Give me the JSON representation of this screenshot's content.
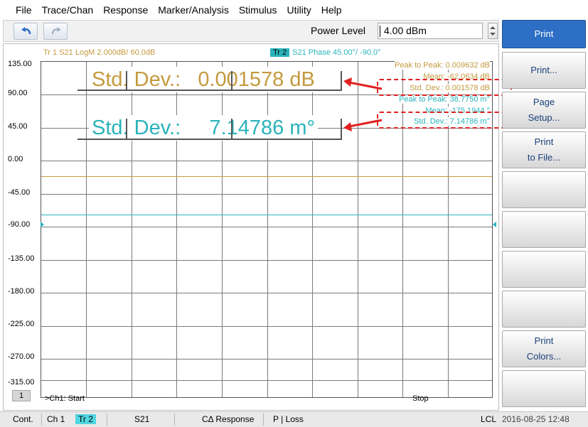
{
  "menu": [
    "File",
    "Trace/Chan",
    "Response",
    "Marker/Analysis",
    "Stimulus",
    "Utility",
    "Help"
  ],
  "toolbar": {
    "undo_icon": "undo-icon",
    "redo_icon": "redo-icon",
    "power_label": "Power Level",
    "power_value": "4.00 dBm"
  },
  "traces": {
    "tr1": "Tr  1   S21 LogM 2.000dB/  60.0dB",
    "tr2_badge": "Tr  2",
    "tr2": "S21 Phase 45.00°/  -90.0°"
  },
  "y_ticks": [
    "135.00",
    "90.00",
    "45.00",
    "0.00",
    "-45.00",
    "-90.00",
    "-135.00",
    "-180.00",
    "-225.00",
    "-270.00",
    "-315.00"
  ],
  "stats": {
    "tr1_peak": "Peak to Peak:  0.009632 dB",
    "tr1_mean": "Mean:  -62.0634 dB",
    "tr1_std": "Std. Dev.:  0.001578 dB",
    "tr2_peak": "Peak to Peak:  38.7750 m°",
    "tr2_mean": "Mean:  -175.1944 °",
    "tr2_std": "Std. Dev.:  7.14786 m°"
  },
  "callouts": {
    "gold_label": "Std. Dev.:",
    "gold_value": "0.001578 dB",
    "cyan_label": "Std. Dev.:",
    "cyan_value": "7.14786 m°"
  },
  "channel": {
    "num": "1",
    "start": ">Ch1:  Start",
    "stop": "Stop"
  },
  "softkeys": [
    "Print",
    "Print...",
    "Page\nSetup...",
    "Print\nto File...",
    "",
    "",
    "",
    "",
    "Print\nColors...",
    ""
  ],
  "status": {
    "mode": "Cont.",
    "channel": "Ch 1",
    "trace": "Tr 2",
    "param": "S21",
    "cal": "CΔ Response",
    "loss": "P | Loss",
    "ref": "LCL",
    "datetime": "2016-08-25 12:48"
  },
  "colors": {
    "trace1": "#c49a3e",
    "trace2": "#2ab3ba",
    "accent": "#2d6fc4",
    "highlight": "#e02020"
  }
}
